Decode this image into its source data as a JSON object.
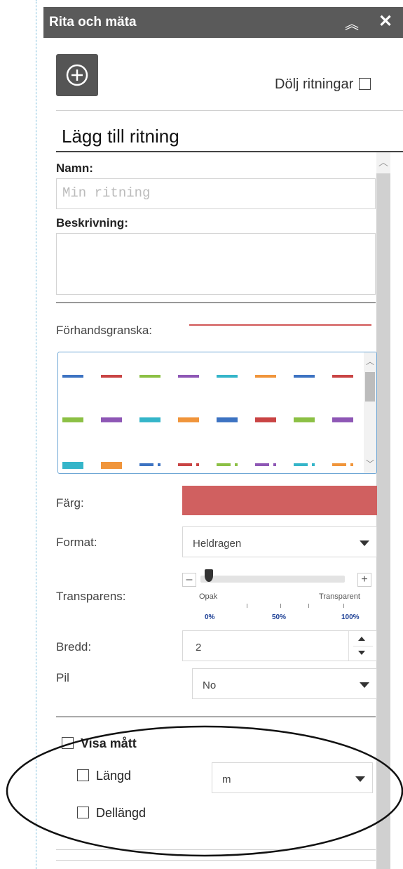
{
  "panel": {
    "title": "Rita och mäta",
    "collapse_icon": "double-chevron-up-icon",
    "close_icon": "close-icon",
    "close_glyph": "✕",
    "collapse_glyph": "︽"
  },
  "toolbar": {
    "add_icon": "plus-circle-icon",
    "hide_drawings_label": "Dölj ritningar",
    "hide_drawings_checked": false
  },
  "form": {
    "section_title": "Lägg till ritning",
    "name_label": "Namn:",
    "name_placeholder": "Min ritning",
    "description_label": "Beskrivning:",
    "preview_label": "Förhandsgranska:",
    "preview_color": "#d05555",
    "color_label": "Färg:",
    "color_value": "#d06060",
    "format_label": "Format:",
    "format_value": "Heldragen",
    "transparency_label": "Transparens:",
    "transparency_min_label": "Opak",
    "transparency_max_label": "Transparent",
    "transparency_ticks": [
      "0%",
      "50%",
      "100%"
    ],
    "transparency_value_percent": 0,
    "width_label": "Bredd:",
    "width_value": "2",
    "arrow_label": "Pil",
    "arrow_value": "No"
  },
  "line_styles": {
    "colors": [
      "#3d73c2",
      "#c94444",
      "#8cc045",
      "#8e57b5",
      "#35b5c9",
      "#f0953b"
    ],
    "row1": [
      "#3d73c2",
      "#c94444",
      "#8cc045",
      "#8e57b5",
      "#35b5c9",
      "#f0953b",
      "#3d73c2",
      "#c94444"
    ],
    "row2": [
      "#8cc045",
      "#8e57b5",
      "#35b5c9",
      "#f0953b",
      "#3d73c2",
      "#c94444",
      "#8cc045",
      "#8e57b5"
    ],
    "row3": [
      "#35b5c9",
      "#f0953b",
      "#3d73c2",
      "#c94444",
      "#8cc045",
      "#8e57b5",
      "#35b5c9",
      "#f0953b"
    ]
  },
  "measure": {
    "show_label": "Visa mått",
    "length_label": "Längd",
    "unit_value": "m",
    "segment_length_label": "Dellängd"
  }
}
